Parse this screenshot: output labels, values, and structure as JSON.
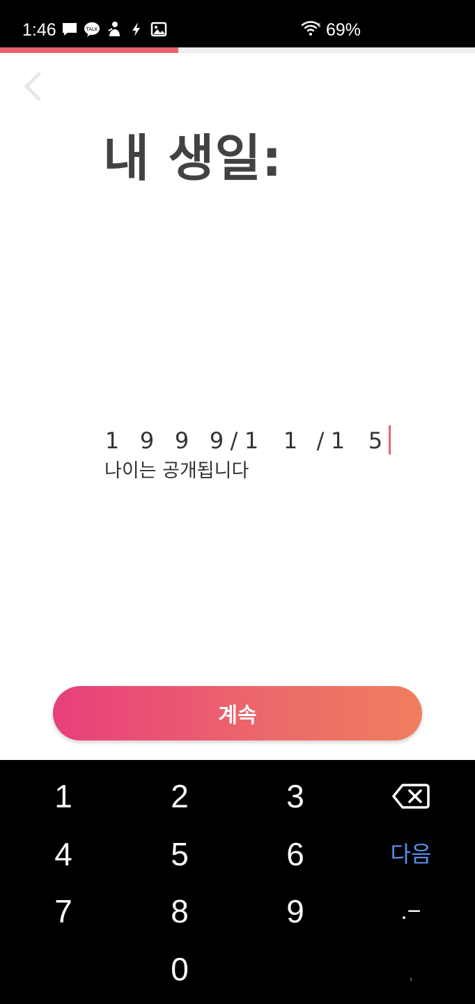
{
  "status_bar": {
    "time": "1:46",
    "battery": "69%",
    "notification_icons": [
      "message-icon",
      "kakaotalk-icon",
      "app-icon",
      "flash-icon",
      "image-icon"
    ],
    "network_icon": "wifi-6-icon"
  },
  "progress": {
    "value": 0.375,
    "color": "#e8636f"
  },
  "header": {
    "back_icon": "chevron-left-icon"
  },
  "title": "내 생일:",
  "birthday": {
    "chars": [
      "1",
      "9",
      "9",
      "9",
      "/",
      "1",
      "1",
      "/",
      "1",
      "5"
    ],
    "note": "나이는 공개됩니다"
  },
  "continue_button": {
    "label": "계속"
  },
  "keyboard": {
    "keys": [
      "1",
      "2",
      "3",
      "4",
      "5",
      "6",
      "7",
      "8",
      "9",
      "0"
    ],
    "backspace_icon": "backspace-icon",
    "next_label": "다음",
    "symbol_label": ".−",
    "comma_label": ","
  },
  "colors": {
    "accent": "#e8636f",
    "gradient_start": "#e83f7b",
    "gradient_end": "#f07e5f",
    "next_key": "#5b8fe8"
  }
}
